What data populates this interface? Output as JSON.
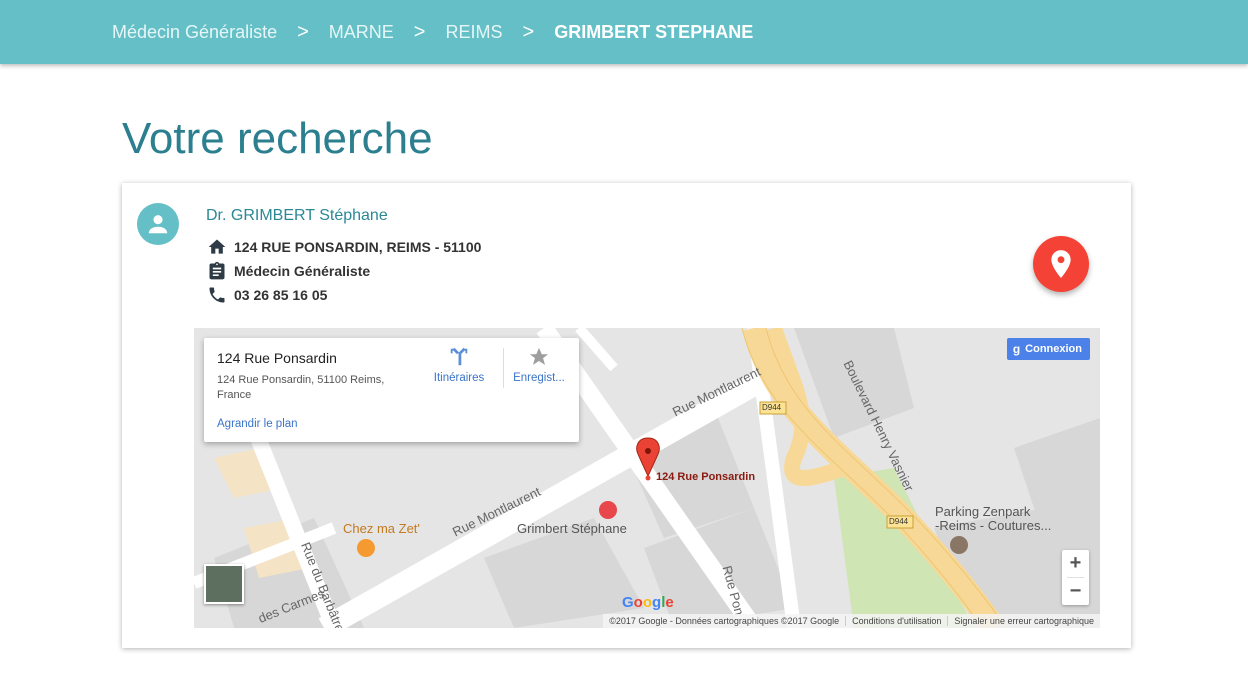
{
  "breadcrumb": {
    "items": [
      "Médecin Généraliste",
      "MARNE",
      "REIMS",
      "GRIMBERT STEPHANE"
    ],
    "separator": ">"
  },
  "page": {
    "title": "Votre recherche"
  },
  "doctor": {
    "name": "Dr. GRIMBERT Stéphane",
    "address": "124 RUE PONSARDIN, REIMS - 51100",
    "specialty": "Médecin Généraliste",
    "phone": "03 26 85 16 05"
  },
  "map": {
    "infowindow": {
      "title": "124 Rue Ponsardin",
      "address": "124 Rue Ponsardin, 51100 Reims, France",
      "directions_label": "Itinéraires",
      "save_label": "Enregist...",
      "enlarge_label": "Agrandir le plan"
    },
    "signin_label": "Connexion",
    "marker_label": "124 Rue Ponsardin",
    "places": {
      "restaurant": "Chez ma Zet'",
      "doctor": "Grimbert Stéphane",
      "parking_line1": "Parking Zenpark",
      "parking_line2": "-Reims - Coutures..."
    },
    "streets": {
      "montlaurent_upper": "Rue Montlaurent",
      "montlaurent_lower": "Rue Montlaurent",
      "barbatre": "Rue du Barbâtre",
      "carmes": "des Carmes",
      "ponsardin": "Rue Pon",
      "boulevard": "Boulevard Henry Vasnier",
      "d944_a": "D944",
      "d944_b": "D944"
    },
    "zoom_in": "+",
    "zoom_out": "−",
    "google_logo": "Google",
    "attribution": [
      "©2017 Google - Données cartographiques ©2017 Google",
      "Conditions d'utilisation",
      "Signaler une erreur cartographique"
    ]
  },
  "colors": {
    "header": "#64c0c6",
    "title": "#2b7f8f",
    "accent_red": "#f44336",
    "link_blue": "#3a74c9"
  }
}
